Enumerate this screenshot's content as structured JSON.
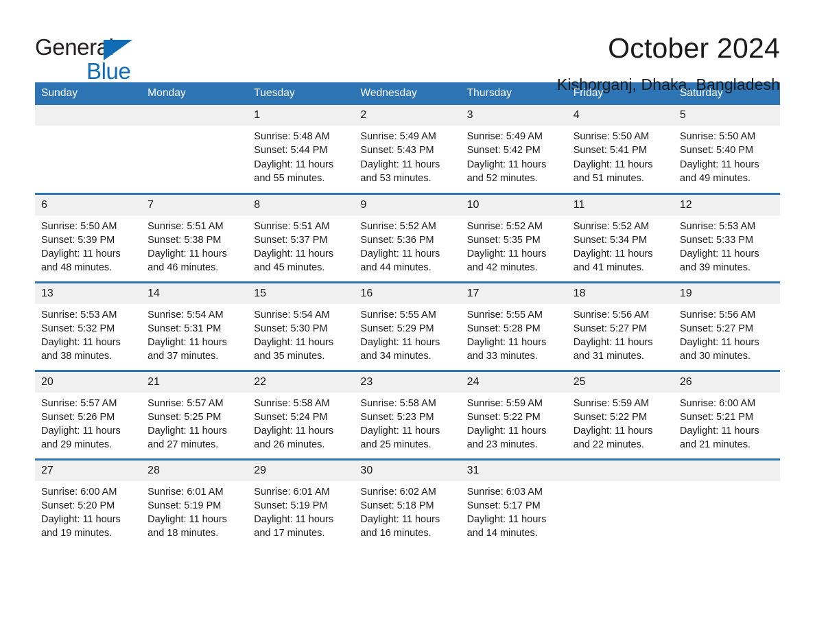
{
  "brand": {
    "name_part1": "General",
    "name_part2": "Blue",
    "triangle_color": "#0f6cb5"
  },
  "header": {
    "title": "October 2024",
    "location": "Kishorganj, Dhaka, Bangladesh",
    "header_bg_color": "#2d74b5",
    "daynum_bg_color": "#f0f0f0"
  },
  "weekdays": [
    "Sunday",
    "Monday",
    "Tuesday",
    "Wednesday",
    "Thursday",
    "Friday",
    "Saturday"
  ],
  "weeks": [
    [
      {
        "day": "",
        "sunrise": "",
        "sunset": "",
        "daylight_line1": "",
        "daylight_line2": ""
      },
      {
        "day": "",
        "sunrise": "",
        "sunset": "",
        "daylight_line1": "",
        "daylight_line2": ""
      },
      {
        "day": "1",
        "sunrise": "Sunrise: 5:48 AM",
        "sunset": "Sunset: 5:44 PM",
        "daylight_line1": "Daylight: 11 hours",
        "daylight_line2": "and 55 minutes."
      },
      {
        "day": "2",
        "sunrise": "Sunrise: 5:49 AM",
        "sunset": "Sunset: 5:43 PM",
        "daylight_line1": "Daylight: 11 hours",
        "daylight_line2": "and 53 minutes."
      },
      {
        "day": "3",
        "sunrise": "Sunrise: 5:49 AM",
        "sunset": "Sunset: 5:42 PM",
        "daylight_line1": "Daylight: 11 hours",
        "daylight_line2": "and 52 minutes."
      },
      {
        "day": "4",
        "sunrise": "Sunrise: 5:50 AM",
        "sunset": "Sunset: 5:41 PM",
        "daylight_line1": "Daylight: 11 hours",
        "daylight_line2": "and 51 minutes."
      },
      {
        "day": "5",
        "sunrise": "Sunrise: 5:50 AM",
        "sunset": "Sunset: 5:40 PM",
        "daylight_line1": "Daylight: 11 hours",
        "daylight_line2": "and 49 minutes."
      }
    ],
    [
      {
        "day": "6",
        "sunrise": "Sunrise: 5:50 AM",
        "sunset": "Sunset: 5:39 PM",
        "daylight_line1": "Daylight: 11 hours",
        "daylight_line2": "and 48 minutes."
      },
      {
        "day": "7",
        "sunrise": "Sunrise: 5:51 AM",
        "sunset": "Sunset: 5:38 PM",
        "daylight_line1": "Daylight: 11 hours",
        "daylight_line2": "and 46 minutes."
      },
      {
        "day": "8",
        "sunrise": "Sunrise: 5:51 AM",
        "sunset": "Sunset: 5:37 PM",
        "daylight_line1": "Daylight: 11 hours",
        "daylight_line2": "and 45 minutes."
      },
      {
        "day": "9",
        "sunrise": "Sunrise: 5:52 AM",
        "sunset": "Sunset: 5:36 PM",
        "daylight_line1": "Daylight: 11 hours",
        "daylight_line2": "and 44 minutes."
      },
      {
        "day": "10",
        "sunrise": "Sunrise: 5:52 AM",
        "sunset": "Sunset: 5:35 PM",
        "daylight_line1": "Daylight: 11 hours",
        "daylight_line2": "and 42 minutes."
      },
      {
        "day": "11",
        "sunrise": "Sunrise: 5:52 AM",
        "sunset": "Sunset: 5:34 PM",
        "daylight_line1": "Daylight: 11 hours",
        "daylight_line2": "and 41 minutes."
      },
      {
        "day": "12",
        "sunrise": "Sunrise: 5:53 AM",
        "sunset": "Sunset: 5:33 PM",
        "daylight_line1": "Daylight: 11 hours",
        "daylight_line2": "and 39 minutes."
      }
    ],
    [
      {
        "day": "13",
        "sunrise": "Sunrise: 5:53 AM",
        "sunset": "Sunset: 5:32 PM",
        "daylight_line1": "Daylight: 11 hours",
        "daylight_line2": "and 38 minutes."
      },
      {
        "day": "14",
        "sunrise": "Sunrise: 5:54 AM",
        "sunset": "Sunset: 5:31 PM",
        "daylight_line1": "Daylight: 11 hours",
        "daylight_line2": "and 37 minutes."
      },
      {
        "day": "15",
        "sunrise": "Sunrise: 5:54 AM",
        "sunset": "Sunset: 5:30 PM",
        "daylight_line1": "Daylight: 11 hours",
        "daylight_line2": "and 35 minutes."
      },
      {
        "day": "16",
        "sunrise": "Sunrise: 5:55 AM",
        "sunset": "Sunset: 5:29 PM",
        "daylight_line1": "Daylight: 11 hours",
        "daylight_line2": "and 34 minutes."
      },
      {
        "day": "17",
        "sunrise": "Sunrise: 5:55 AM",
        "sunset": "Sunset: 5:28 PM",
        "daylight_line1": "Daylight: 11 hours",
        "daylight_line2": "and 33 minutes."
      },
      {
        "day": "18",
        "sunrise": "Sunrise: 5:56 AM",
        "sunset": "Sunset: 5:27 PM",
        "daylight_line1": "Daylight: 11 hours",
        "daylight_line2": "and 31 minutes."
      },
      {
        "day": "19",
        "sunrise": "Sunrise: 5:56 AM",
        "sunset": "Sunset: 5:27 PM",
        "daylight_line1": "Daylight: 11 hours",
        "daylight_line2": "and 30 minutes."
      }
    ],
    [
      {
        "day": "20",
        "sunrise": "Sunrise: 5:57 AM",
        "sunset": "Sunset: 5:26 PM",
        "daylight_line1": "Daylight: 11 hours",
        "daylight_line2": "and 29 minutes."
      },
      {
        "day": "21",
        "sunrise": "Sunrise: 5:57 AM",
        "sunset": "Sunset: 5:25 PM",
        "daylight_line1": "Daylight: 11 hours",
        "daylight_line2": "and 27 minutes."
      },
      {
        "day": "22",
        "sunrise": "Sunrise: 5:58 AM",
        "sunset": "Sunset: 5:24 PM",
        "daylight_line1": "Daylight: 11 hours",
        "daylight_line2": "and 26 minutes."
      },
      {
        "day": "23",
        "sunrise": "Sunrise: 5:58 AM",
        "sunset": "Sunset: 5:23 PM",
        "daylight_line1": "Daylight: 11 hours",
        "daylight_line2": "and 25 minutes."
      },
      {
        "day": "24",
        "sunrise": "Sunrise: 5:59 AM",
        "sunset": "Sunset: 5:22 PM",
        "daylight_line1": "Daylight: 11 hours",
        "daylight_line2": "and 23 minutes."
      },
      {
        "day": "25",
        "sunrise": "Sunrise: 5:59 AM",
        "sunset": "Sunset: 5:22 PM",
        "daylight_line1": "Daylight: 11 hours",
        "daylight_line2": "and 22 minutes."
      },
      {
        "day": "26",
        "sunrise": "Sunrise: 6:00 AM",
        "sunset": "Sunset: 5:21 PM",
        "daylight_line1": "Daylight: 11 hours",
        "daylight_line2": "and 21 minutes."
      }
    ],
    [
      {
        "day": "27",
        "sunrise": "Sunrise: 6:00 AM",
        "sunset": "Sunset: 5:20 PM",
        "daylight_line1": "Daylight: 11 hours",
        "daylight_line2": "and 19 minutes."
      },
      {
        "day": "28",
        "sunrise": "Sunrise: 6:01 AM",
        "sunset": "Sunset: 5:19 PM",
        "daylight_line1": "Daylight: 11 hours",
        "daylight_line2": "and 18 minutes."
      },
      {
        "day": "29",
        "sunrise": "Sunrise: 6:01 AM",
        "sunset": "Sunset: 5:19 PM",
        "daylight_line1": "Daylight: 11 hours",
        "daylight_line2": "and 17 minutes."
      },
      {
        "day": "30",
        "sunrise": "Sunrise: 6:02 AM",
        "sunset": "Sunset: 5:18 PM",
        "daylight_line1": "Daylight: 11 hours",
        "daylight_line2": "and 16 minutes."
      },
      {
        "day": "31",
        "sunrise": "Sunrise: 6:03 AM",
        "sunset": "Sunset: 5:17 PM",
        "daylight_line1": "Daylight: 11 hours",
        "daylight_line2": "and 14 minutes."
      },
      {
        "day": "",
        "sunrise": "",
        "sunset": "",
        "daylight_line1": "",
        "daylight_line2": ""
      },
      {
        "day": "",
        "sunrise": "",
        "sunset": "",
        "daylight_line1": "",
        "daylight_line2": ""
      }
    ]
  ]
}
